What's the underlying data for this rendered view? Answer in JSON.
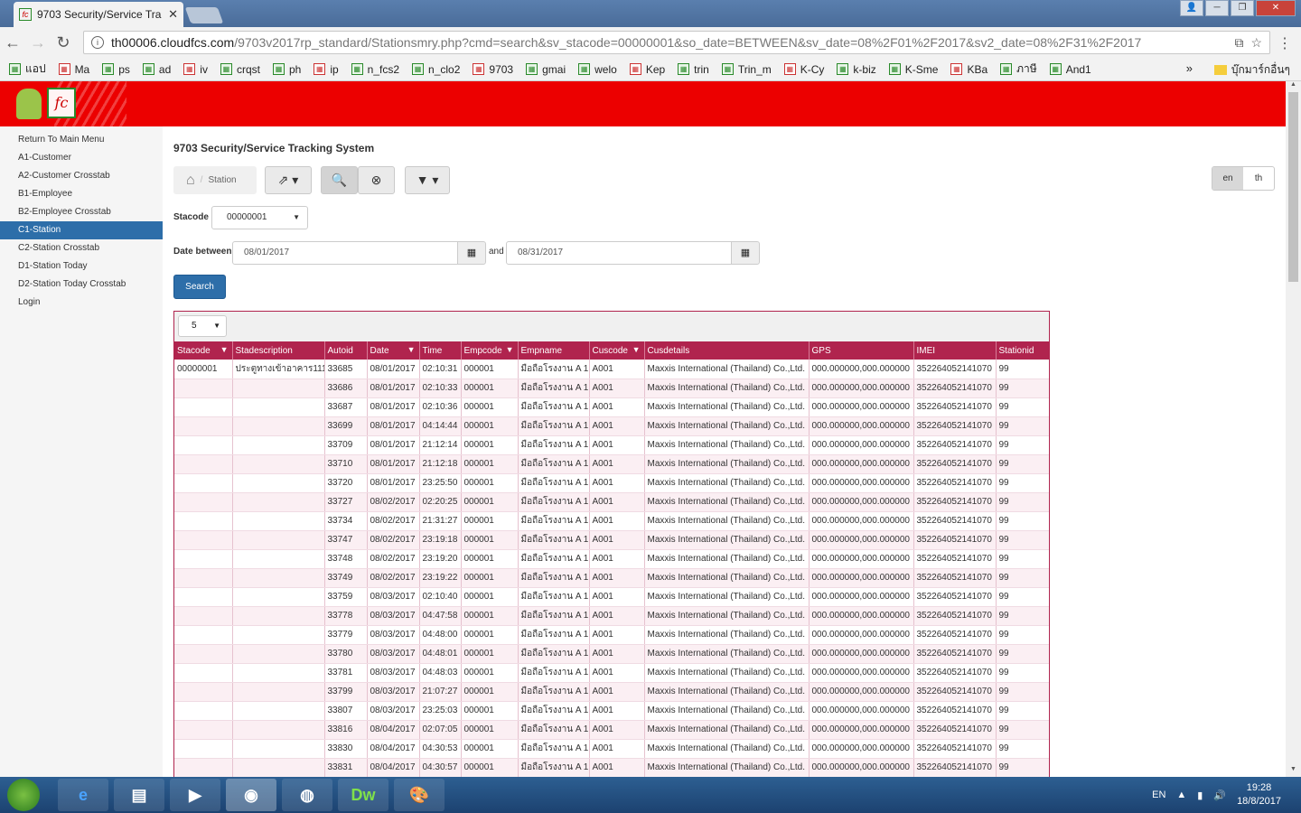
{
  "browser": {
    "tab_title": "9703 Security/Service Tra",
    "url_host": "th00006.cloudfcs.com",
    "url_rest": "/9703v2017rp_standard/Stationsmry.php?cmd=search&sv_stacode=00000001&so_date=BETWEEN&sv_date=08%2F01%2F2017&sv2_date=08%2F31%2F2017",
    "bookmarks": [
      "แอป",
      "Ma",
      "ps",
      "ad",
      "iv",
      "crqst",
      "ph",
      "ip",
      "n_fcs2",
      "n_clo2",
      "9703",
      "gmai",
      "welo",
      "Kep",
      "trin",
      "Trin_m",
      "K-Cy",
      "k-biz",
      "K-Sme",
      "KBa",
      "ภาษี",
      "And1"
    ],
    "bookmarks_overflow": "»",
    "other_bookmarks": "บุ๊กมาร์กอื่นๆ"
  },
  "sidebar": {
    "items": [
      {
        "label": "Return To Main Menu"
      },
      {
        "label": "A1-Customer"
      },
      {
        "label": "A2-Customer Crosstab"
      },
      {
        "label": "B1-Employee"
      },
      {
        "label": "B2-Employee Crosstab"
      },
      {
        "label": "C1-Station"
      },
      {
        "label": "C2-Station Crosstab"
      },
      {
        "label": "D1-Station Today"
      },
      {
        "label": "D2-Station Today Crosstab"
      },
      {
        "label": "Login"
      }
    ],
    "active_index": 5
  },
  "page": {
    "title": "9703 Security/Service Tracking System",
    "breadcrumb": "Station",
    "lang_en": "en",
    "lang_th": "th"
  },
  "form": {
    "stacode_label": "Stacode",
    "stacode_value": "00000001",
    "date_label": "Date between",
    "date_from": "08/01/2017",
    "and_label": "and",
    "date_to": "08/31/2017",
    "search_label": "Search"
  },
  "grid": {
    "page_size": "5",
    "columns": [
      "Stacode",
      "Stadescription",
      "Autoid",
      "Date",
      "Time",
      "Empcode",
      "Empname",
      "Cuscode",
      "Cusdetails",
      "GPS",
      "IMEI",
      "Stationid"
    ],
    "rows": [
      [
        "00000001",
        "ประตูทางเข้าอาคาร111",
        "33685",
        "08/01/2017",
        "02:10:31",
        "000001",
        "มือถือโรงงาน A 1",
        "A001",
        "Maxxis International (Thailand) Co.,Ltd.",
        "000.000000,000.000000",
        "352264052141070",
        "99"
      ],
      [
        "",
        "",
        "33686",
        "08/01/2017",
        "02:10:33",
        "000001",
        "มือถือโรงงาน A 1",
        "A001",
        "Maxxis International (Thailand) Co.,Ltd.",
        "000.000000,000.000000",
        "352264052141070",
        "99"
      ],
      [
        "",
        "",
        "33687",
        "08/01/2017",
        "02:10:36",
        "000001",
        "มือถือโรงงาน A 1",
        "A001",
        "Maxxis International (Thailand) Co.,Ltd.",
        "000.000000,000.000000",
        "352264052141070",
        "99"
      ],
      [
        "",
        "",
        "33699",
        "08/01/2017",
        "04:14:44",
        "000001",
        "มือถือโรงงาน A 1",
        "A001",
        "Maxxis International (Thailand) Co.,Ltd.",
        "000.000000,000.000000",
        "352264052141070",
        "99"
      ],
      [
        "",
        "",
        "33709",
        "08/01/2017",
        "21:12:14",
        "000001",
        "มือถือโรงงาน A 1",
        "A001",
        "Maxxis International (Thailand) Co.,Ltd.",
        "000.000000,000.000000",
        "352264052141070",
        "99"
      ],
      [
        "",
        "",
        "33710",
        "08/01/2017",
        "21:12:18",
        "000001",
        "มือถือโรงงาน A 1",
        "A001",
        "Maxxis International (Thailand) Co.,Ltd.",
        "000.000000,000.000000",
        "352264052141070",
        "99"
      ],
      [
        "",
        "",
        "33720",
        "08/01/2017",
        "23:25:50",
        "000001",
        "มือถือโรงงาน A 1",
        "A001",
        "Maxxis International (Thailand) Co.,Ltd.",
        "000.000000,000.000000",
        "352264052141070",
        "99"
      ],
      [
        "",
        "",
        "33727",
        "08/02/2017",
        "02:20:25",
        "000001",
        "มือถือโรงงาน A 1",
        "A001",
        "Maxxis International (Thailand) Co.,Ltd.",
        "000.000000,000.000000",
        "352264052141070",
        "99"
      ],
      [
        "",
        "",
        "33734",
        "08/02/2017",
        "21:31:27",
        "000001",
        "มือถือโรงงาน A 1",
        "A001",
        "Maxxis International (Thailand) Co.,Ltd.",
        "000.000000,000.000000",
        "352264052141070",
        "99"
      ],
      [
        "",
        "",
        "33747",
        "08/02/2017",
        "23:19:18",
        "000001",
        "มือถือโรงงาน A 1",
        "A001",
        "Maxxis International (Thailand) Co.,Ltd.",
        "000.000000,000.000000",
        "352264052141070",
        "99"
      ],
      [
        "",
        "",
        "33748",
        "08/02/2017",
        "23:19:20",
        "000001",
        "มือถือโรงงาน A 1",
        "A001",
        "Maxxis International (Thailand) Co.,Ltd.",
        "000.000000,000.000000",
        "352264052141070",
        "99"
      ],
      [
        "",
        "",
        "33749",
        "08/02/2017",
        "23:19:22",
        "000001",
        "มือถือโรงงาน A 1",
        "A001",
        "Maxxis International (Thailand) Co.,Ltd.",
        "000.000000,000.000000",
        "352264052141070",
        "99"
      ],
      [
        "",
        "",
        "33759",
        "08/03/2017",
        "02:10:40",
        "000001",
        "มือถือโรงงาน A 1",
        "A001",
        "Maxxis International (Thailand) Co.,Ltd.",
        "000.000000,000.000000",
        "352264052141070",
        "99"
      ],
      [
        "",
        "",
        "33778",
        "08/03/2017",
        "04:47:58",
        "000001",
        "มือถือโรงงาน A 1",
        "A001",
        "Maxxis International (Thailand) Co.,Ltd.",
        "000.000000,000.000000",
        "352264052141070",
        "99"
      ],
      [
        "",
        "",
        "33779",
        "08/03/2017",
        "04:48:00",
        "000001",
        "มือถือโรงงาน A 1",
        "A001",
        "Maxxis International (Thailand) Co.,Ltd.",
        "000.000000,000.000000",
        "352264052141070",
        "99"
      ],
      [
        "",
        "",
        "33780",
        "08/03/2017",
        "04:48:01",
        "000001",
        "มือถือโรงงาน A 1",
        "A001",
        "Maxxis International (Thailand) Co.,Ltd.",
        "000.000000,000.000000",
        "352264052141070",
        "99"
      ],
      [
        "",
        "",
        "33781",
        "08/03/2017",
        "04:48:03",
        "000001",
        "มือถือโรงงาน A 1",
        "A001",
        "Maxxis International (Thailand) Co.,Ltd.",
        "000.000000,000.000000",
        "352264052141070",
        "99"
      ],
      [
        "",
        "",
        "33799",
        "08/03/2017",
        "21:07:27",
        "000001",
        "มือถือโรงงาน A 1",
        "A001",
        "Maxxis International (Thailand) Co.,Ltd.",
        "000.000000,000.000000",
        "352264052141070",
        "99"
      ],
      [
        "",
        "",
        "33807",
        "08/03/2017",
        "23:25:03",
        "000001",
        "มือถือโรงงาน A 1",
        "A001",
        "Maxxis International (Thailand) Co.,Ltd.",
        "000.000000,000.000000",
        "352264052141070",
        "99"
      ],
      [
        "",
        "",
        "33816",
        "08/04/2017",
        "02:07:05",
        "000001",
        "มือถือโรงงาน A 1",
        "A001",
        "Maxxis International (Thailand) Co.,Ltd.",
        "000.000000,000.000000",
        "352264052141070",
        "99"
      ],
      [
        "",
        "",
        "33830",
        "08/04/2017",
        "04:30:53",
        "000001",
        "มือถือโรงงาน A 1",
        "A001",
        "Maxxis International (Thailand) Co.,Ltd.",
        "000.000000,000.000000",
        "352264052141070",
        "99"
      ],
      [
        "",
        "",
        "33831",
        "08/04/2017",
        "04:30:57",
        "000001",
        "มือถือโรงงาน A 1",
        "A001",
        "Maxxis International (Thailand) Co.,Ltd.",
        "000.000000,000.000000",
        "352264052141070",
        "99"
      ]
    ],
    "filter_columns": [
      "Stacode",
      "Date",
      "Empcode",
      "Cuscode"
    ]
  },
  "taskbar": {
    "lang": "EN",
    "time": "19:28",
    "date": "18/8/2017",
    "apps": [
      "ie",
      "explorer",
      "media",
      "chrome",
      "firefox",
      "Dw",
      "paint"
    ]
  },
  "colors": {
    "header_red": "#ec0000",
    "grid_header": "#b0244e",
    "active_blue": "#2d6ea9"
  }
}
